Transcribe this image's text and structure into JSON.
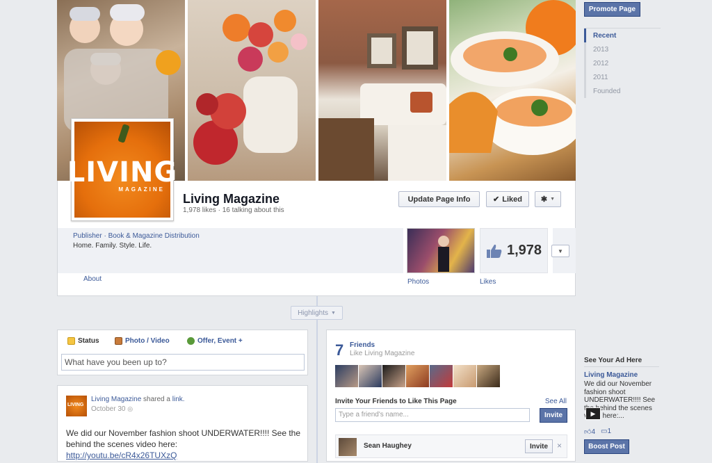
{
  "page": {
    "name": "Living Magazine",
    "stats": "1,978 likes · 16 talking about this",
    "logo_word": "LIVING",
    "logo_sub": "MAGAZINE"
  },
  "actions": {
    "update_info": "Update Page Info",
    "liked": "Liked"
  },
  "info": {
    "category": "Publisher · Book & Magazine Distribution",
    "tagline": "Home. Family. Style. Life.",
    "about": "About"
  },
  "apps": {
    "photos_label": "Photos",
    "likes_label": "Likes",
    "likes_count": "1,978"
  },
  "timeline": {
    "highlights": "Highlights"
  },
  "composer": {
    "tabs": [
      "Status",
      "Photo / Video",
      "Offer, Event +"
    ],
    "placeholder": "What have you been up to?"
  },
  "post": {
    "avatar_text": "LIVING",
    "author": "Living Magazine",
    "action": "shared a",
    "object": "link.",
    "date": "October 30",
    "text": "We did our November fashion shoot UNDERWATER!!!! See the behind the scenes video here:",
    "link": "http://youtu.be/cR4x26TUXzQ"
  },
  "friends": {
    "count": "7",
    "title": "Friends",
    "subtitle": "Like Living Magazine",
    "invite_title": "Invite Your Friends to Like This Page",
    "see_all": "See All",
    "input_placeholder": "Type a friend's name...",
    "invite_button": "Invite",
    "suggested": {
      "name": "Sean Haughey",
      "invite": "Invite",
      "dismiss": "×"
    }
  },
  "sidebar": {
    "promote": "Promote Page",
    "years": [
      "Recent",
      "2013",
      "2012",
      "2011",
      "Founded"
    ],
    "ad": {
      "heading": "See Your Ad Here",
      "title": "Living Magazine",
      "body": "We did our November fashion shoot UNDERWATER!!!! See the behind the scenes video here:...",
      "likes": "4",
      "comments": "1",
      "boost": "Boost Post"
    }
  },
  "colors": {
    "brand": "#3b5998",
    "button_blue": "#5b74a8",
    "background": "#e9ebee"
  }
}
